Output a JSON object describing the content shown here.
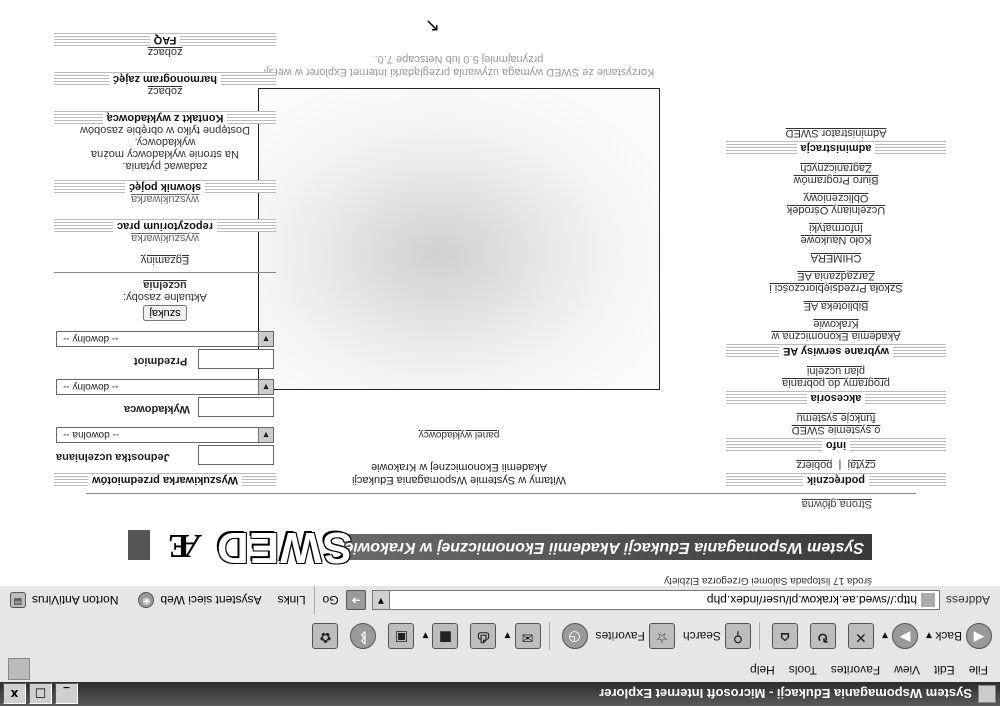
{
  "window": {
    "title": "System Wspomagania Edukacji - Microsoft Internet Explorer",
    "buttons": [
      "_",
      "□",
      "x"
    ]
  },
  "menu": [
    "File",
    "Edit",
    "View",
    "Favorites",
    "Tools",
    "Help"
  ],
  "toolbar": {
    "back": "Back",
    "search": "Search",
    "favorites": "Favorites"
  },
  "addressbar": {
    "label": "Address",
    "url": "http://swed.ae.krakow.pl/user/index.php",
    "go": "Go",
    "links": "Links",
    "assistant": "Asystent sieci Web",
    "norton": "Norton AntiVirus"
  },
  "header": {
    "date_line": "środa 17 listopada   Salomei Grzegorza Elżbiety",
    "banner_text": "System Wspomagania Edukacji Akademii Ekonomicznej w Krakowie",
    "logo": "SWED",
    "emblem": "Æ",
    "home_link": "Strona główna"
  },
  "center": {
    "welcome_line1": "Witamy w Systemie Wspomagania Edukacji",
    "welcome_line2": "Akademii Ekonomicznej w Krakowie",
    "panel_link": "panel wykładowcy",
    "notice_line1": "Korzystanie ze SWED wymaga używania przeglądarki Internet Explorer w wersji",
    "notice_line2": "przynajmniej 5.0 lub Netscape 7.0."
  },
  "search": {
    "title": "Wyszukiwarka przedmiotów",
    "unit_label": "Jednostka uczelniana",
    "unit_select": "-- dowolna --",
    "lecturer_label": "Wykładowca",
    "lecturer_select": "-- dowolny --",
    "subject_label": "Przedmiot",
    "subject_select": "-- dowolny --",
    "button": "szukaj"
  },
  "resources": {
    "label": "Aktualne zasoby:",
    "link": "uczelnia",
    "exams": "Egzaminy",
    "repo_title": "repozytorium prac",
    "repo_link": "wyszukiwarka",
    "dict_title": "słownik pojęć",
    "dict_link": "wyszukiwarka",
    "contact_title": "Kontakt z wykładowcą",
    "contact_text1": "Dostępne tylko w obrębie zasobów",
    "contact_text2": "wykładowcy.",
    "contact_text3": "Na stronie wykładowcy można",
    "contact_text4": "zadawać pytania.",
    "schedule_title": "harmonogram zajęć",
    "schedule_link": "zobacz",
    "faq_title": "FAQ",
    "faq_link": "zobacz"
  },
  "sidebar": {
    "manual_title": "podręcznik",
    "manual_read": "czytaj",
    "manual_sep": "|",
    "manual_download": "pobierz",
    "info_title": "info",
    "info_links": [
      "o systemie SWED",
      "funkcje systemu"
    ],
    "accessories_title": "akcesoria",
    "accessories_links": [
      "programy do pobrania",
      "plan uczelni"
    ],
    "services_title": "wybrane serwisy AE",
    "services_links": [
      "Akademia Ekonomiczna w Krakowie",
      "Biblioteka AE",
      "Szkoła Przedsiębiorczości i Zarządzania AE",
      "CHIMERA",
      "Koło Naukowe Informatyki",
      "Uczelniany Ośrodek Obliczeniowy",
      "Biuro Programów Zagranicznych"
    ],
    "admin_title": "administracja",
    "admin_link": "Administrator SWED"
  }
}
